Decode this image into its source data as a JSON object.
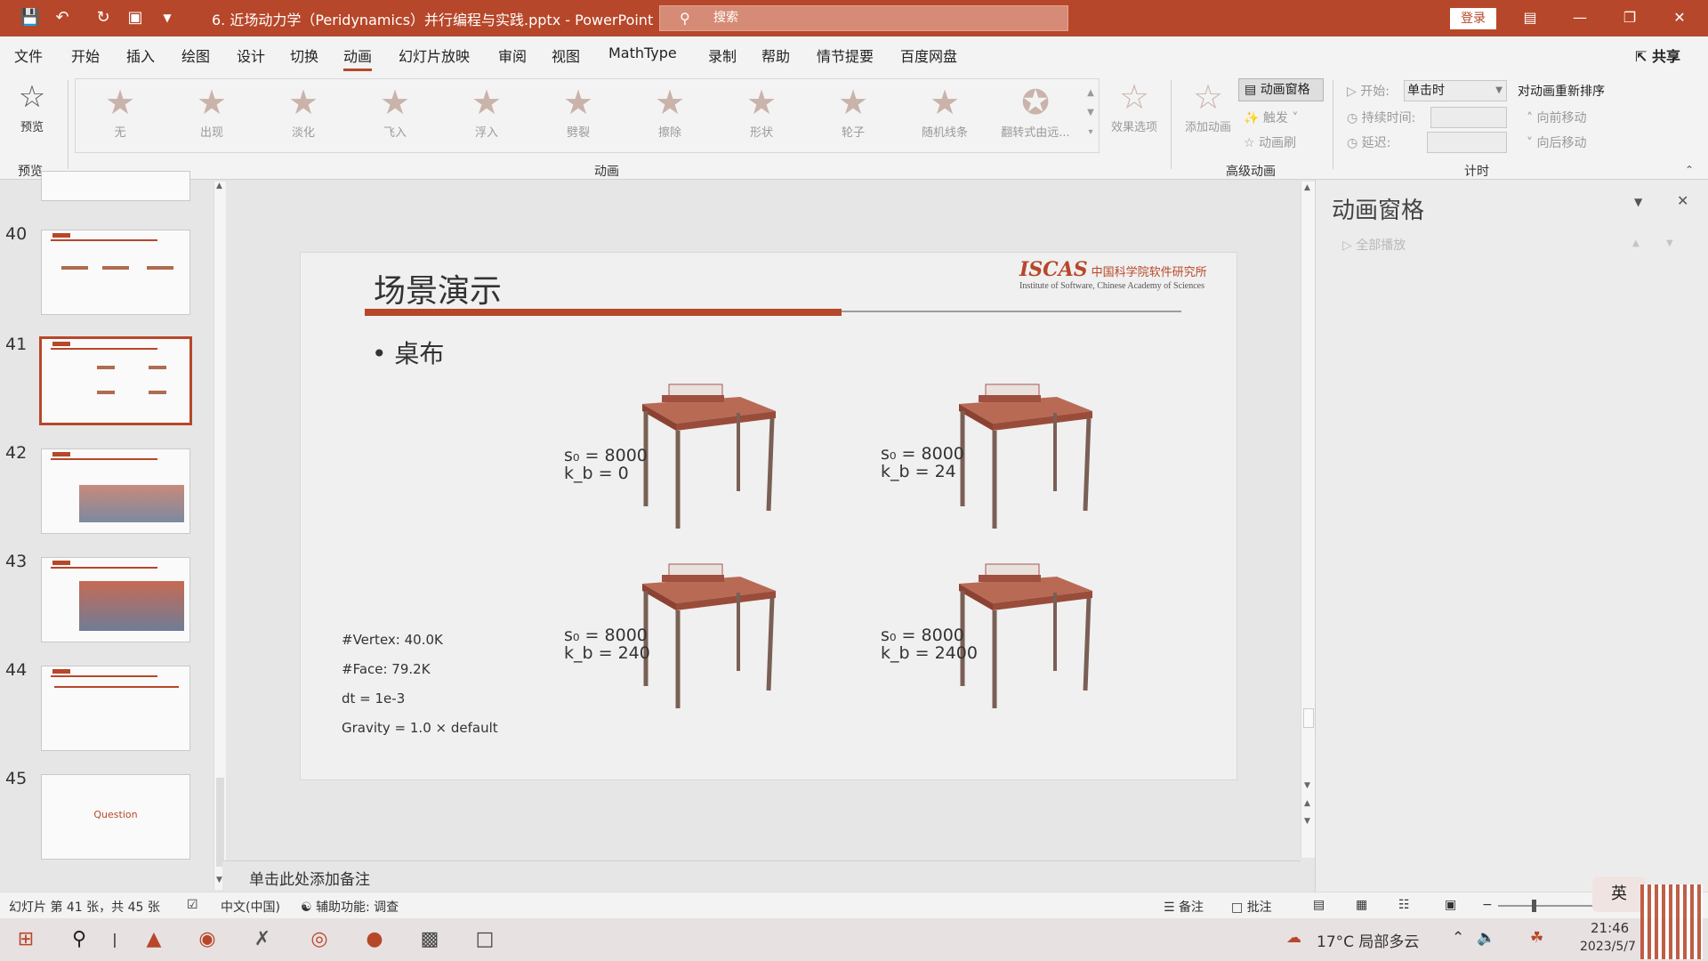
{
  "titlebar": {
    "document_title": "6. 近场动力学（Peridynamics）并行编程与实践.pptx - PowerPoint",
    "search_placeholder": "搜索",
    "login_label": "登录"
  },
  "menu": {
    "tabs": [
      "文件",
      "开始",
      "插入",
      "绘图",
      "设计",
      "切换",
      "动画",
      "幻灯片放映",
      "审阅",
      "视图",
      "MathType",
      "录制",
      "帮助",
      "情节提要",
      "百度网盘"
    ],
    "active_index": 6,
    "share_label": "共享"
  },
  "ribbon": {
    "preview_label": "预览",
    "preview_group": "预览",
    "animations": [
      "无",
      "出现",
      "淡化",
      "飞入",
      "浮入",
      "劈裂",
      "擦除",
      "形状",
      "轮子",
      "随机线条",
      "翻转式由远..."
    ],
    "effect_options": "效果选项",
    "animation_group": "动画",
    "add_animation": "添加动画",
    "animation_pane_btn": "动画窗格",
    "trigger": "触发",
    "anim_painter": "动画刷",
    "advanced_group": "高级动画",
    "start_label": "开始:",
    "start_value": "单击时",
    "duration_label": "持续时间:",
    "delay_label": "延迟:",
    "reorder_title": "对动画重新排序",
    "move_earlier": "向前移动",
    "move_later": "向后移动",
    "timing_group": "计时"
  },
  "thumbnails": [
    {
      "num": "40"
    },
    {
      "num": "41",
      "selected": true
    },
    {
      "num": "42"
    },
    {
      "num": "43"
    },
    {
      "num": "44"
    },
    {
      "num": "45",
      "text": "Question"
    }
  ],
  "slide": {
    "title": "场景演示",
    "logo_text": "ISCAS",
    "logo_cn": "中国科学院软件研究所",
    "logo_en": "Institute of Software, Chinese Academy of Sciences",
    "bullet": "• 桌布",
    "params": [
      {
        "s0": "s₀ = 8000",
        "kb": "k_b = 0"
      },
      {
        "s0": "s₀ = 8000",
        "kb": "k_b = 24"
      },
      {
        "s0": "s₀ = 8000",
        "kb": "k_b = 240"
      },
      {
        "s0": "s₀ = 8000",
        "kb": "k_b = 2400"
      }
    ],
    "info": [
      "#Vertex:  40.0K",
      "#Face:  79.2K",
      "dt = 1e-3",
      "Gravity = 1.0 × default"
    ]
  },
  "notes_placeholder": "单击此处添加备注",
  "anim_pane": {
    "title": "动画窗格",
    "play_all": "全部播放"
  },
  "status": {
    "slide_counter": "幻灯片 第 41 张，共 45 张",
    "language": "中文(中国)",
    "accessibility": "辅助功能: 调查",
    "notes_btn": "备注",
    "comments_btn": "批注"
  },
  "taskbar": {
    "weather": "17°C  局部多云",
    "ime": "英",
    "time": "21:46",
    "date": "2023/5/7"
  },
  "colors": {
    "accent": "#b7472a"
  }
}
